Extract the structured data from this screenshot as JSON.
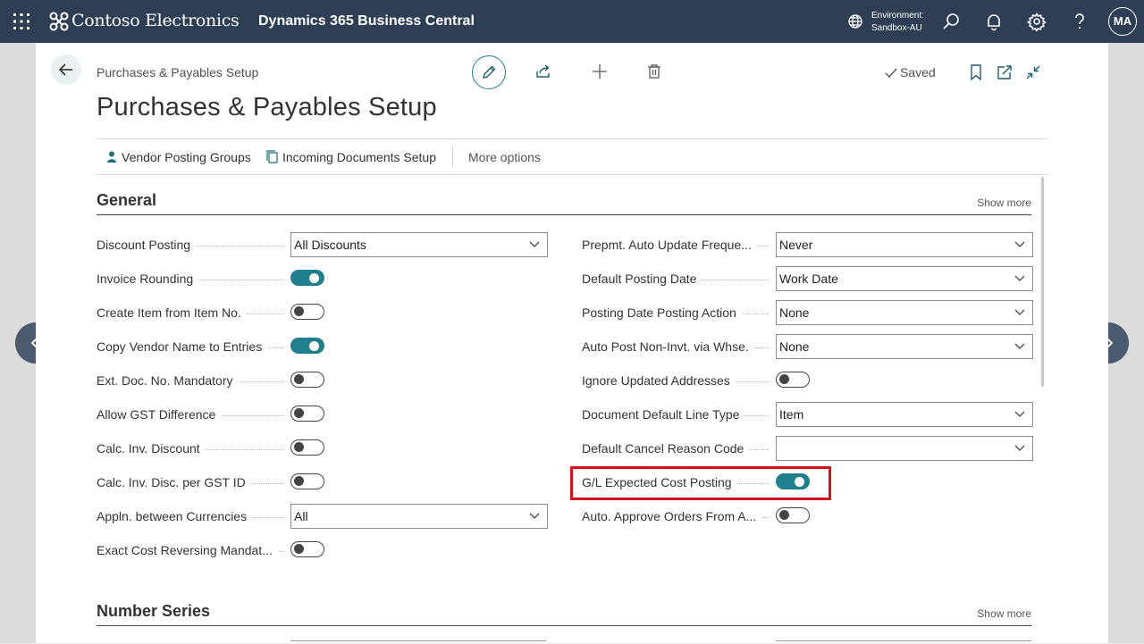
{
  "topbar": {
    "brand": "Contoso Electronics",
    "product": "Dynamics 365 Business Central",
    "environment_label": "Environment:",
    "environment_value": "Sandbox-AU",
    "avatar_initials": "MA"
  },
  "header": {
    "breadcrumb": "Purchases & Payables Setup",
    "saved_label": "Saved",
    "title": "Purchases & Payables Setup"
  },
  "actions": {
    "vendor_posting_groups": "Vendor Posting Groups",
    "incoming_documents_setup": "Incoming Documents Setup",
    "more_options": "More options"
  },
  "sections": {
    "general": {
      "title": "General",
      "show_more": "Show more"
    },
    "number_series": {
      "title": "Number Series",
      "show_more": "Show more"
    }
  },
  "fields_left": [
    {
      "label": "Discount Posting",
      "kind": "select",
      "value": "All Discounts"
    },
    {
      "label": "Invoice Rounding",
      "kind": "toggle",
      "on": true
    },
    {
      "label": "Create Item from Item No.",
      "kind": "toggle",
      "on": false
    },
    {
      "label": "Copy Vendor Name to Entries",
      "kind": "toggle",
      "on": true
    },
    {
      "label": "Ext. Doc. No. Mandatory",
      "kind": "toggle",
      "on": false
    },
    {
      "label": "Allow GST Difference",
      "kind": "toggle",
      "on": false
    },
    {
      "label": "Calc. Inv. Discount",
      "kind": "toggle",
      "on": false
    },
    {
      "label": "Calc. Inv. Disc. per GST ID",
      "kind": "toggle",
      "on": false
    },
    {
      "label": "Appln. between Currencies",
      "kind": "select",
      "value": "All"
    },
    {
      "label": "Exact Cost Reversing Mandat...",
      "kind": "toggle",
      "on": false
    }
  ],
  "fields_right": [
    {
      "label": "Prepmt. Auto Update Freque...",
      "kind": "select",
      "value": "Never"
    },
    {
      "label": "Default Posting Date",
      "kind": "select",
      "value": "Work Date"
    },
    {
      "label": "Posting Date Posting Action",
      "kind": "select",
      "value": "None"
    },
    {
      "label": "Auto Post Non-Invt. via Whse.",
      "kind": "select",
      "value": "None"
    },
    {
      "label": "Ignore Updated Addresses",
      "kind": "toggle",
      "on": false
    },
    {
      "label": "Document Default Line Type",
      "kind": "select",
      "value": "Item"
    },
    {
      "label": "Default Cancel Reason Code",
      "kind": "select",
      "value": ""
    },
    {
      "label": "G/L Expected Cost Posting",
      "kind": "toggle",
      "on": true
    },
    {
      "label": "Auto. Approve Orders From A...",
      "kind": "toggle",
      "on": false
    }
  ],
  "icons": {
    "waffle": "waffle-icon",
    "logo": "contoso-logo-icon",
    "environment": "globe-icon",
    "search": "search-icon",
    "notifications": "bell-icon",
    "settings": "gear-icon",
    "help": "help-icon",
    "back": "back-arrow-icon",
    "edit": "pencil-icon",
    "share": "share-icon",
    "new": "plus-icon",
    "delete": "trash-icon",
    "saved": "check-icon",
    "bookmark": "bookmark-icon",
    "open_new": "open-in-new-window-icon",
    "collapse": "collapse-icon",
    "prev": "chevron-left-icon",
    "next": "chevron-right-icon"
  },
  "colors": {
    "topbar": "#2e3f55",
    "accent": "#1f7f8c",
    "highlight": "#d3111b"
  }
}
